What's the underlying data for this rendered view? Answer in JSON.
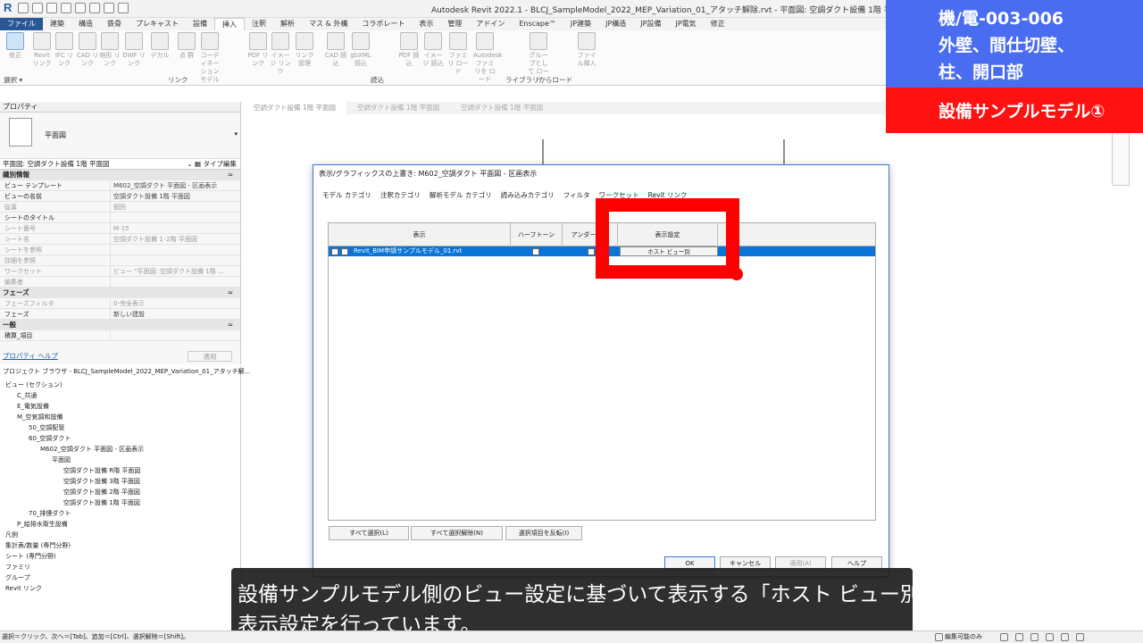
{
  "window": {
    "title": "Autodesk Revit 2022.1 - BLCJ_SampleModel_2022_MEP_Variation_01_アタッチ解除.rvt - 平面図: 空調ダクト設備 1階 平面図"
  },
  "ribbon": {
    "tabs": [
      "ファイル",
      "建築",
      "構造",
      "鉄骨",
      "プレキャスト",
      "設備",
      "挿入",
      "注釈",
      "解析",
      "マス & 外構",
      "コラボレート",
      "表示",
      "管理",
      "アドイン",
      "Enscape™",
      "JP建築",
      "JP構造",
      "JP設備",
      "JP電気",
      "修正"
    ],
    "active_tab": "挿入",
    "buttons": [
      {
        "label": "修正",
        "icon": "cursor-icon"
      },
      {
        "label": "Revit リンク",
        "icon": "revit-link-icon"
      },
      {
        "label": "IFC リンク",
        "icon": "ifc-link-icon"
      },
      {
        "label": "CAD リンク",
        "icon": "cad-link-icon"
      },
      {
        "label": "地形 リンク",
        "icon": "topo-link-icon"
      },
      {
        "label": "DWF リンク",
        "icon": "dwf-link-icon"
      },
      {
        "label": "デカル",
        "icon": "decal-icon"
      },
      {
        "label": "点 群",
        "icon": "pointcloud-icon"
      },
      {
        "label": "コーディネーション モデル",
        "icon": "coordination-icon"
      },
      {
        "label": "PDF リンク",
        "icon": "pdf-link-icon"
      },
      {
        "label": "イメージ リンク",
        "icon": "image-link-icon"
      },
      {
        "label": "リンク 管理",
        "icon": "manage-links-icon"
      },
      {
        "label": "CAD 読込",
        "icon": "cad-import-icon"
      },
      {
        "label": "gbXML 読込",
        "icon": "gbxml-icon"
      },
      {
        "label": "PDF 読込",
        "icon": "pdf-import-icon"
      },
      {
        "label": "イメージ 読込",
        "icon": "image-import-icon"
      },
      {
        "label": "ファミリ ロード",
        "icon": "family-load-icon"
      },
      {
        "label": "Autodesk ファミリを ロード",
        "icon": "autodesk-family-icon"
      },
      {
        "label": "グループとして ロード",
        "icon": "group-load-icon"
      },
      {
        "label": "ファイル挿入",
        "icon": "insert-file-icon"
      }
    ],
    "groups": [
      "選択 ▾",
      "リンク",
      "読込",
      "ライブラリからロード"
    ]
  },
  "properties": {
    "title": "プロパティ",
    "type_label": "平面図",
    "selector": "平面図: 空調ダクト設備 1階 平面図",
    "edit_type": "タイプ編集",
    "sections": [
      {
        "name": "識別情報",
        "rows": [
          {
            "k": "ビュー テンプレート",
            "v": "M602_空調ダクト 平面図 - 区画表示",
            "gray": false
          },
          {
            "k": "ビューの名前",
            "v": "空調ダクト設備 1階 平面図",
            "gray": false
          },
          {
            "k": "従属",
            "v": "個別",
            "gray": true
          },
          {
            "k": "シートのタイトル",
            "v": "",
            "gray": false
          },
          {
            "k": "シート番号",
            "v": "M-15",
            "gray": true
          },
          {
            "k": "シート名",
            "v": "空調ダクト設備 1･2階 平面図",
            "gray": true
          },
          {
            "k": "シートを参照",
            "v": "",
            "gray": true
          },
          {
            "k": "詳細を参照",
            "v": "",
            "gray": true
          },
          {
            "k": "ワークセット",
            "v": "ビュー \"平面図: 空調ダクト設備 1階 ...",
            "gray": true
          },
          {
            "k": "編集者",
            "v": "",
            "gray": true
          }
        ]
      },
      {
        "name": "フェーズ",
        "rows": [
          {
            "k": "フェーズフィルタ",
            "v": "0-完全表示",
            "gray": true
          },
          {
            "k": "フェーズ",
            "v": "新しい建設",
            "gray": false
          }
        ]
      },
      {
        "name": "一般",
        "rows": [
          {
            "k": "積算_項目",
            "v": "",
            "gray": false
          }
        ]
      }
    ],
    "help": "プロパティ ヘルプ",
    "apply": "適用"
  },
  "browser": {
    "title": "プロジェクト ブラウザ - BLCJ_SampleModel_2022_MEP_Variation_01_アタッチ解...",
    "items": [
      {
        "label": "ビュー (セクション)",
        "level": 0
      },
      {
        "label": "C_共通",
        "level": 1
      },
      {
        "label": "E_電気設備",
        "level": 1
      },
      {
        "label": "M_空気調和設備",
        "level": 1
      },
      {
        "label": "50_空調配管",
        "level": 2
      },
      {
        "label": "60_空調ダクト",
        "level": 2
      },
      {
        "label": "M602_空調ダクト 平面図 - 区画表示",
        "level": 3
      },
      {
        "label": "平面図",
        "level": 4
      },
      {
        "label": "空調ダクト設備 R階 平面図",
        "level": 5
      },
      {
        "label": "空調ダクト設備 3階 平面図",
        "level": 5
      },
      {
        "label": "空調ダクト設備 2階 平面図",
        "level": 5
      },
      {
        "label": "空調ダクト設備 1階 平面図",
        "level": 5
      },
      {
        "label": "70_排煙ダクト",
        "level": 2
      },
      {
        "label": "P_給排水衛生設備",
        "level": 1
      },
      {
        "label": "凡例",
        "level": 0
      },
      {
        "label": "集計表/数量 (専門分野)",
        "level": 0
      },
      {
        "label": "シート (専門分野)",
        "level": 0
      },
      {
        "label": "ファミリ",
        "level": 0
      },
      {
        "label": "グループ",
        "level": 0
      },
      {
        "label": "Revit リンク",
        "level": 0
      }
    ]
  },
  "view_tabs": [
    "空調ダクト設備 1階 平面図",
    "空調ダクト設備 1階 平面図",
    "空調ダクト設備 1階 平面図"
  ],
  "dialog": {
    "title": "表示/グラフィックスの上書き: M602_空調ダクト 平面図 - 区画表示",
    "tabs": [
      "モデル カテゴリ",
      "注釈カテゴリ",
      "解析モデル カテゴリ",
      "読み込みカテゴリ",
      "フィルタ",
      "ワークセット",
      "Revit リンク"
    ],
    "active_tab": "Revit リンク",
    "columns": [
      "表示",
      "ハーフトーン",
      "アンダーレイ",
      "表示設定"
    ],
    "row": {
      "name": "Revit_BIM申請サンプルモデル_01.rvt",
      "display_setting": "ホスト ビュー別"
    },
    "buttons": {
      "select_all": "すべて選択(L)",
      "deselect_all": "すべて選択解除(N)",
      "invert": "選択項目を反転(I)",
      "ok": "OK",
      "cancel": "キャンセル",
      "apply": "適用(A)",
      "help": "ヘルプ"
    }
  },
  "overlay": {
    "code": "機/電-003-006",
    "line2": "外壁、間仕切壁、",
    "line3": "柱、開口部",
    "model": "設備サンプルモデル①"
  },
  "caption": {
    "line1": "設備サンプルモデル側のビュー設定に基づいて表示する「ホスト ビュー別」の",
    "line2": "表示設定を行っています。"
  },
  "status": {
    "hint": "選択＝クリック、次へ＝[Tab]、追加＝[Ctrl]、選択解除＝[Shift]。",
    "editable": "編集可能のみ"
  },
  "colors": {
    "accent": "#3b78d8",
    "highlight": "#ff0000",
    "overlay_blue": "#4a6cf0",
    "overlay_red": "#ff1111"
  }
}
